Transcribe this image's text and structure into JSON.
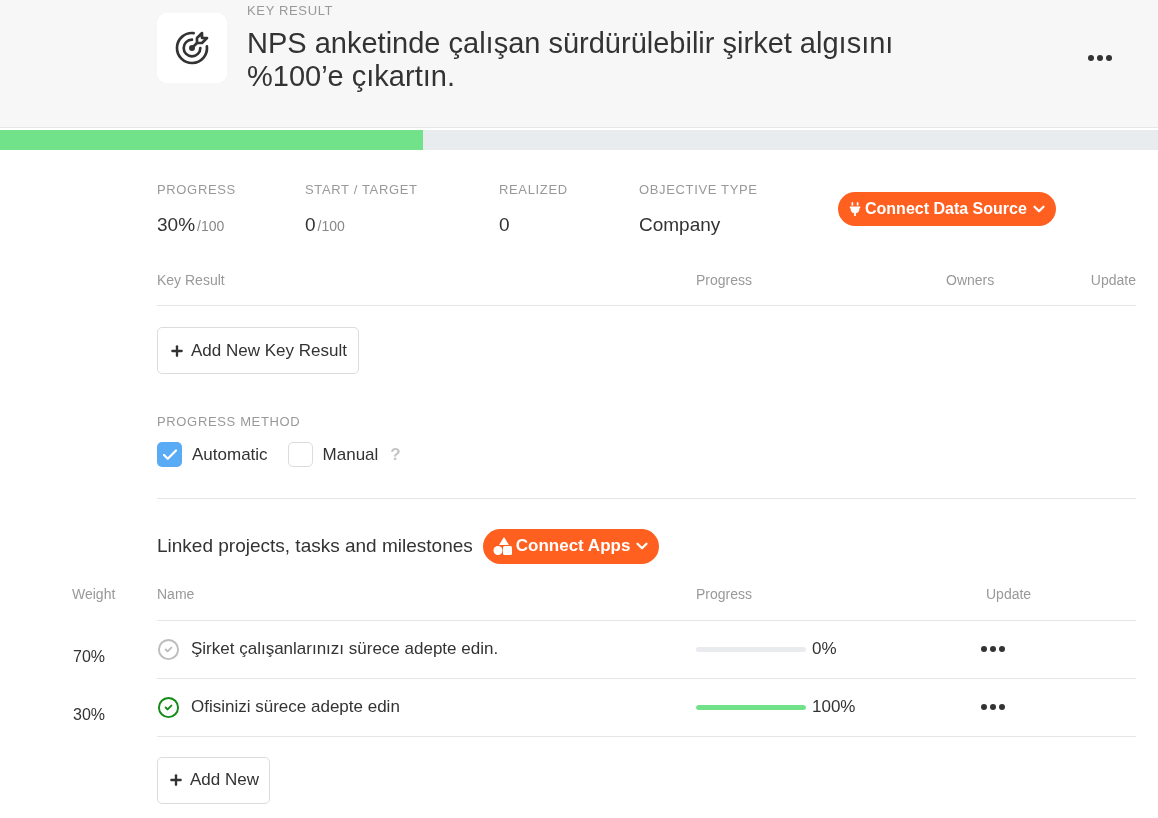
{
  "header": {
    "eyebrow": "KEY RESULT",
    "title": "NPS anketinde çalışan sürdürülebilir şirket algısını %100’e çıkartın."
  },
  "progress_bar": {
    "level": 0.365
  },
  "stats": [
    {
      "label": "PROGRESS",
      "value": "30%",
      "suffix": "/100"
    },
    {
      "label": "START / TARGET",
      "value": "0",
      "suffix": "/100"
    },
    {
      "label": "REALIZED",
      "value": "0"
    },
    {
      "label": "OBJECTIVE TYPE",
      "value": "Company"
    }
  ],
  "connect_data_source": {
    "label": "Connect Data Source"
  },
  "key_results_table": {
    "columns": [
      "Key Result",
      "Progress",
      "Owners",
      "Update"
    ]
  },
  "add_key_result": {
    "label": "Add New Key Result"
  },
  "progress_method": {
    "title": "PROGRESS METHOD",
    "options": [
      {
        "label": "Automatic",
        "checked": true
      },
      {
        "label": "Manual",
        "checked": false,
        "help": "?"
      }
    ]
  },
  "linked": {
    "title": "Linked projects, tasks and milestones",
    "connect_apps": "Connect Apps",
    "columns": [
      "Weight",
      "Name",
      "Progress",
      "Update"
    ],
    "rows": [
      {
        "weight": "70%",
        "name": "Şirket çalışanlarınızı sürece adepte edin.",
        "done": false,
        "level": 0,
        "reading": "0%"
      },
      {
        "weight": "30%",
        "name": "Ofisinizi sürece adepte edin",
        "done": true,
        "level": 1,
        "reading": "100%"
      }
    ],
    "add": "Add New"
  }
}
